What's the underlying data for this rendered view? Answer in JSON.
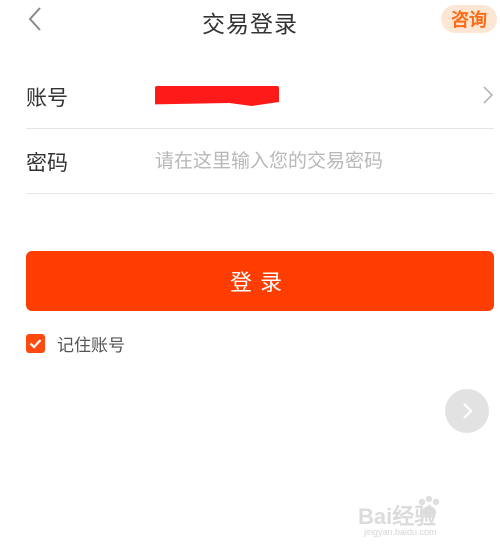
{
  "header": {
    "title": "交易登录",
    "consult_label": "咨询"
  },
  "form": {
    "account": {
      "label": "账号",
      "value": ""
    },
    "password": {
      "label": "密码",
      "value": "",
      "placeholder": "请在这里输入您的交易密码"
    }
  },
  "login_button": {
    "label": "登录"
  },
  "remember": {
    "label": "记住账号",
    "checked": true
  },
  "watermark": {
    "text": "Bai经验",
    "sub": "jingyan.baidu.com"
  },
  "colors": {
    "accent": "#ff3d00",
    "consult_bg": "#fde6d4",
    "consult_text": "#ff6a14",
    "redaction": "#ff1a1a"
  },
  "icons": {
    "back": "chevron-left-icon",
    "account_arrow": "chevron-right-icon",
    "checkbox": "checkmark-icon",
    "next": "chevron-right-icon",
    "watermark": "paw-icon"
  }
}
